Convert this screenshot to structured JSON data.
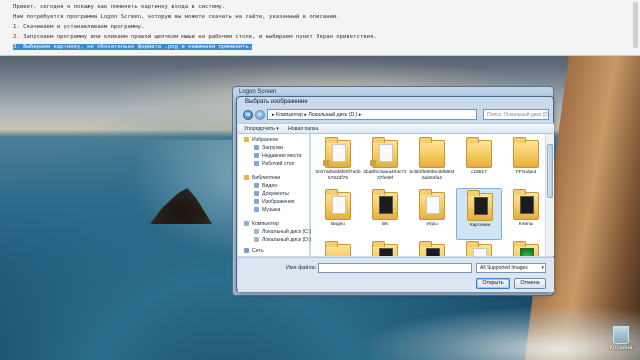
{
  "document": {
    "lines": [
      "Привет, сегодня я покажу как поменять картинку входа в систему.",
      "Нам потребуется программа Logon Screen, которую вы можете скачать на сайте, указанный в описании.",
      "1. Скачиваем и устанавливаем программу.",
      "2. Запускаем программу или кликаем правой щелчком мыши на рабочем столе, и выбираем пункт Экран приветствия.",
      "3. Выбираем картинку, не обязательно формата .png и нажимаем применить."
    ],
    "selected_line_index": 4
  },
  "logon_window": {
    "title": "Logon Screen"
  },
  "dialog": {
    "title": "Выбрать изображение",
    "address": "▸ Компьютер ▸ Локальный диск (D:) ▸",
    "search_placeholder": "Поиск: Локальный диск (D:)",
    "toolbar": {
      "organize": "Упорядочить ▾",
      "new_folder": "Новая папка"
    },
    "nav": {
      "favorites": "Избранное",
      "downloads": "Загрузки",
      "recent": "Недавние места",
      "desktop": "Рабочий стол",
      "libraries": "Библиотеки",
      "video": "Видео",
      "documents": "Документы",
      "images": "Изображения",
      "music": "Музыка",
      "computer": "Компьютер",
      "disk_c": "Локальный диск (C:)",
      "disk_d": "Локальный диск (D:)",
      "network": "Сеть"
    },
    "files": [
      {
        "name": "0c07a65dd8fe0f7a0b5782df76",
        "kind": "folder-doc",
        "lock": true
      },
      {
        "name": "2ba8f2c6aea404c7137fe69f",
        "kind": "folder-doc",
        "lock": true
      },
      {
        "name": "bc5b0fe80be45f58045ab84fa2",
        "kind": "folder",
        "lock": false
      },
      {
        "name": "c18817",
        "kind": "folder",
        "lock": false
      },
      {
        "name": "FFOutput",
        "kind": "folder",
        "lock": false
      },
      {
        "name": "Видео",
        "kind": "folder-doc",
        "lock": false
      },
      {
        "name": "ВК",
        "kind": "folder-dark",
        "lock": false
      },
      {
        "name": "Игры",
        "kind": "folder-doc",
        "lock": false
      },
      {
        "name": "Картинки",
        "kind": "folder-dark",
        "lock": false,
        "selected": true
      },
      {
        "name": "Клипы",
        "kind": "folder-dark",
        "lock": false
      },
      {
        "name": "",
        "kind": "folder",
        "lock": false
      },
      {
        "name": "",
        "kind": "folder-dark",
        "lock": false
      },
      {
        "name": "",
        "kind": "folder-dark",
        "lock": false
      },
      {
        "name": "",
        "kind": "folder-doc",
        "lock": false
      },
      {
        "name": "",
        "kind": "folder-green",
        "lock": false
      }
    ],
    "filename_label": "Имя файла:",
    "filename_value": "",
    "filter": "All Supported Images",
    "open_button": "Открыть",
    "cancel_button": "Отмена"
  },
  "desktop": {
    "recycle_bin_label": "Корзина"
  }
}
